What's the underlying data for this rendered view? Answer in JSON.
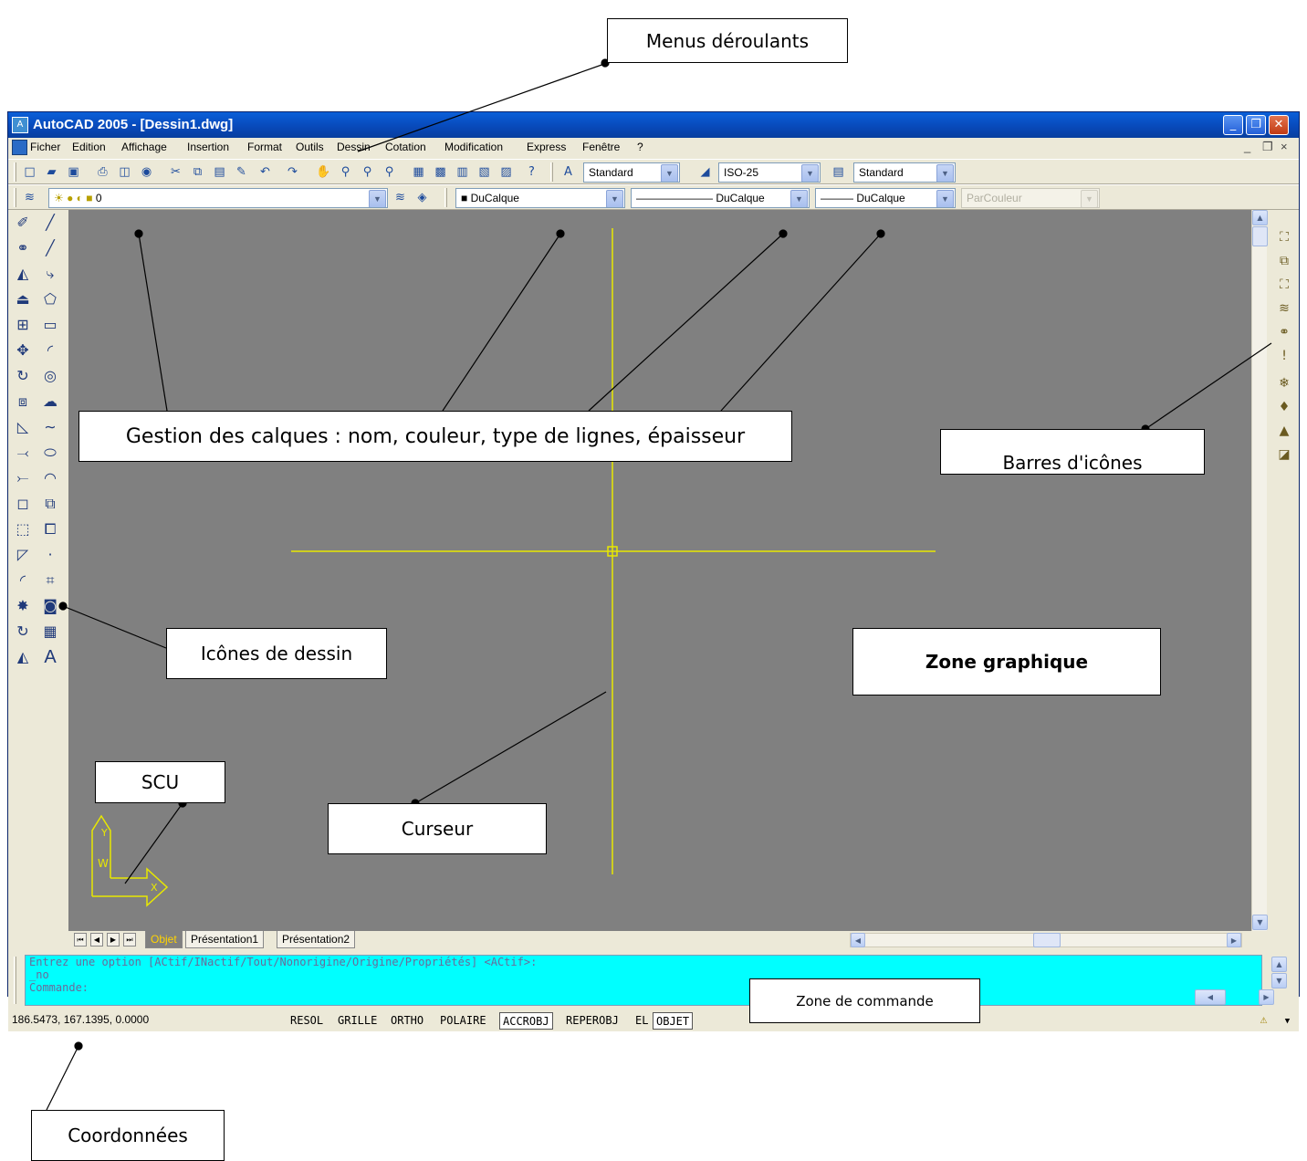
{
  "window": {
    "title": "AutoCAD 2005 - [Dessin1.dwg]",
    "app_icon_glyph": "A",
    "minimize_glyph": "_",
    "restore_glyph": "❐",
    "close_glyph": "✕"
  },
  "menubar": {
    "items": [
      "Ficher",
      "Edition",
      "Affichage",
      "Insertion",
      "Format",
      "Outils",
      "Dessin",
      "Cotation",
      "Modification",
      "Express",
      "Fenêtre",
      "?"
    ],
    "mdi_minimize": "_",
    "mdi_restore": "❐",
    "mdi_close": "×"
  },
  "styles_toolbar": {
    "text_style": "Standard",
    "dim_style": "ISO-25",
    "table_style": "Standard"
  },
  "layers_toolbar": {
    "layer_name": "0",
    "color": "DuCalque",
    "linetype": "DuCalque",
    "lineweight": "DuCalque",
    "plot_style": "ParCouleur"
  },
  "layout_tabs": {
    "model": "Objet",
    "layout1": "Présentation1",
    "layout2": "Présentation2"
  },
  "command_line": {
    "line1": "Entrez une option [ACtif/INactif/Tout/Nonorigine/Origine/Propriétés] <ACtif>:",
    "line2": "_no",
    "prompt": "Commande:"
  },
  "statusbar": {
    "coordinates": "186.5473, 167.1395, 0.0000",
    "buttons": [
      {
        "label": "RESOL",
        "on": false
      },
      {
        "label": "GRILLE",
        "on": false
      },
      {
        "label": "ORTHO",
        "on": false
      },
      {
        "label": "POLAIRE",
        "on": false
      },
      {
        "label": "ACCROBJ",
        "on": true
      },
      {
        "label": "REPEROBJ",
        "on": false
      },
      {
        "label": "EL",
        "on": false
      },
      {
        "label": "OBJET",
        "on": true
      }
    ]
  },
  "ucs": {
    "x_label": "X",
    "y_label": "Y",
    "w_label": "W"
  },
  "annotations": {
    "menus": "Menus déroulants",
    "layers": "Gestion des calques : nom, couleur, type de lignes, épaisseur",
    "icon_bars": "Barres d'icônes",
    "draw_icons": "Icônes de dessin",
    "graphic_zone": "Zone graphique",
    "ucs": "SCU",
    "cursor": "Curseur",
    "command_zone": "Zone de commande",
    "coordinates": "Coordonnées"
  },
  "colors": {
    "canvas": "#808080",
    "cursor": "#e8e800",
    "command_background": "#00ffff",
    "titlebar": "#0848b8"
  }
}
